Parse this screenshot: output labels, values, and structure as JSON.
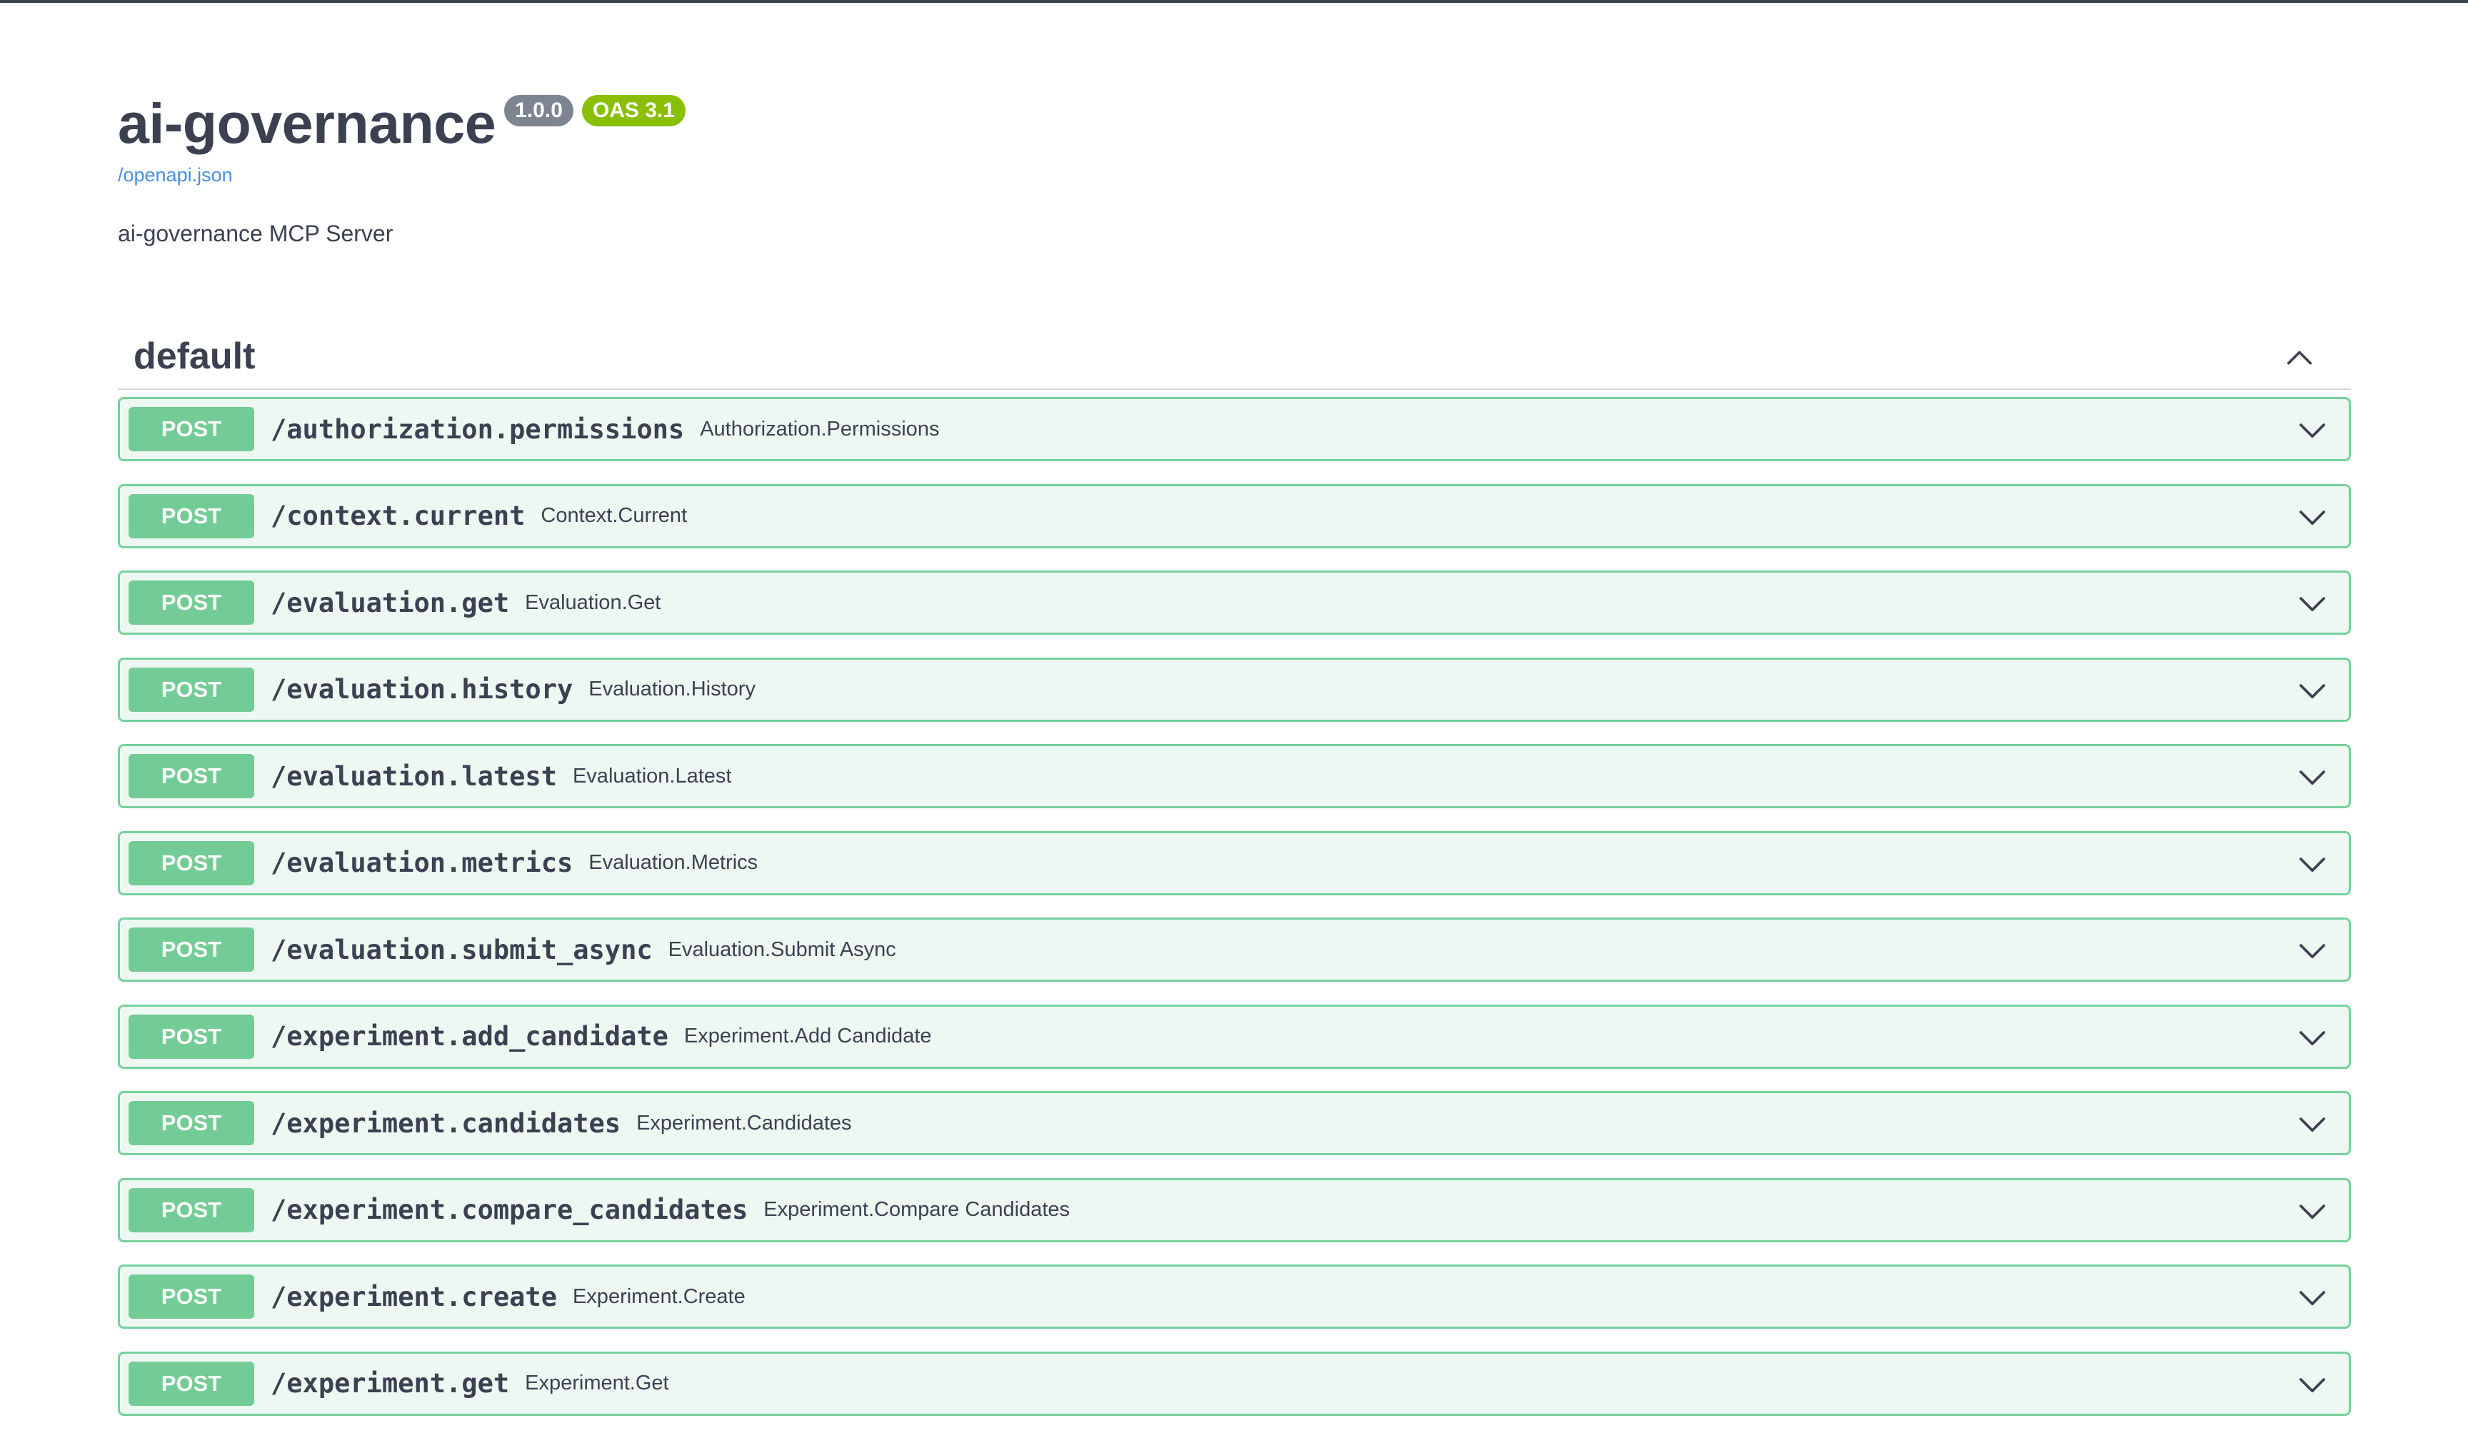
{
  "info": {
    "title": "ai-governance",
    "version": "1.0.0",
    "oas": "OAS 3.1",
    "spec_link": "/openapi.json",
    "description": "ai-governance MCP Server"
  },
  "section": {
    "title": "default"
  },
  "operations": [
    {
      "method": "POST",
      "path": "/authorization.permissions",
      "summary": "Authorization.Permissions"
    },
    {
      "method": "POST",
      "path": "/context.current",
      "summary": "Context.Current"
    },
    {
      "method": "POST",
      "path": "/evaluation.get",
      "summary": "Evaluation.Get"
    },
    {
      "method": "POST",
      "path": "/evaluation.history",
      "summary": "Evaluation.History"
    },
    {
      "method": "POST",
      "path": "/evaluation.latest",
      "summary": "Evaluation.Latest"
    },
    {
      "method": "POST",
      "path": "/evaluation.metrics",
      "summary": "Evaluation.Metrics"
    },
    {
      "method": "POST",
      "path": "/evaluation.submit_async",
      "summary": "Evaluation.Submit Async"
    },
    {
      "method": "POST",
      "path": "/experiment.add_candidate",
      "summary": "Experiment.Add Candidate"
    },
    {
      "method": "POST",
      "path": "/experiment.candidates",
      "summary": "Experiment.Candidates"
    },
    {
      "method": "POST",
      "path": "/experiment.compare_candidates",
      "summary": "Experiment.Compare Candidates"
    },
    {
      "method": "POST",
      "path": "/experiment.create",
      "summary": "Experiment.Create"
    },
    {
      "method": "POST",
      "path": "/experiment.get",
      "summary": "Experiment.Get"
    }
  ],
  "colors": {
    "post_method": "#73cc95",
    "post_border": "#76d19c",
    "post_background": "#eef8f3",
    "version_badge": "#7d8492",
    "oas_badge": "#89bf04",
    "link": "#4990e2"
  },
  "icons": {
    "section_toggle": "chevron-up-icon",
    "operation_toggle": "chevron-down-icon"
  }
}
